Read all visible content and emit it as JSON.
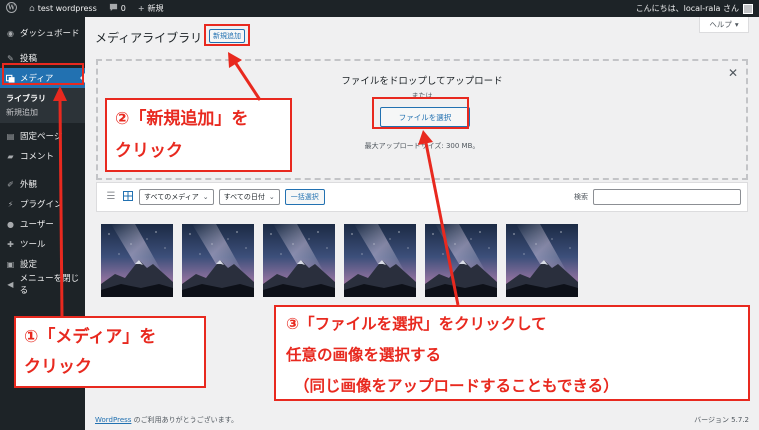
{
  "adminbar": {
    "site_name": "test wordpress",
    "comment_count": "0",
    "new_label": "新規",
    "greeting": "こんにちは、local-rala さん"
  },
  "sidebar": {
    "items": [
      {
        "label": "ダッシュボード",
        "icon": "dashboard-icon"
      },
      {
        "label": "投稿",
        "icon": "pin-icon"
      },
      {
        "label": "メディア",
        "icon": "media-icon"
      },
      {
        "label": "固定ページ",
        "icon": "page-icon"
      },
      {
        "label": "コメント",
        "icon": "comment-icon"
      },
      {
        "label": "外観",
        "icon": "brush-icon"
      },
      {
        "label": "プラグイン",
        "icon": "plugin-icon"
      },
      {
        "label": "ユーザー",
        "icon": "user-icon"
      },
      {
        "label": "ツール",
        "icon": "wrench-icon"
      },
      {
        "label": "設定",
        "icon": "settings-icon"
      },
      {
        "label": "メニューを閉じる",
        "icon": "collapse-icon"
      }
    ],
    "submenu": [
      "ライブラリ",
      "新規追加"
    ]
  },
  "main": {
    "help_label": "ヘルプ",
    "page_title": "メディアライブラリ",
    "add_new_label": "新規追加",
    "uploader": {
      "title": "ファイルをドロップしてアップロード",
      "or_text": "または",
      "select_button": "ファイルを選択",
      "max_size": "最大アップロードサイズ: 300 MB。"
    },
    "toolbar": {
      "filter_media": "すべてのメディア",
      "filter_date": "すべての日付",
      "bulk_select": "一括選択",
      "search_label": "検索"
    },
    "thumbnail_count": 6,
    "footer_link": "WordPress",
    "footer_text": " のご利用ありがとうございます。",
    "version": "バージョン 5.7.2"
  },
  "annotations": {
    "step1_line1": "①「メディア」を",
    "step1_line2": "クリック",
    "step2_line1": "②「新規追加」を",
    "step2_line2": "クリック",
    "step3_line1": "③「ファイルを選択」をクリックして",
    "step3_line2": "任意の画像を選択する",
    "step3_line3": "（同じ画像をアップロードすることもできる）",
    "color": "#e8291f"
  },
  "colors": {
    "adminbar_bg": "#1d2327",
    "active_menu": "#2271b1",
    "link": "#2271b1"
  }
}
